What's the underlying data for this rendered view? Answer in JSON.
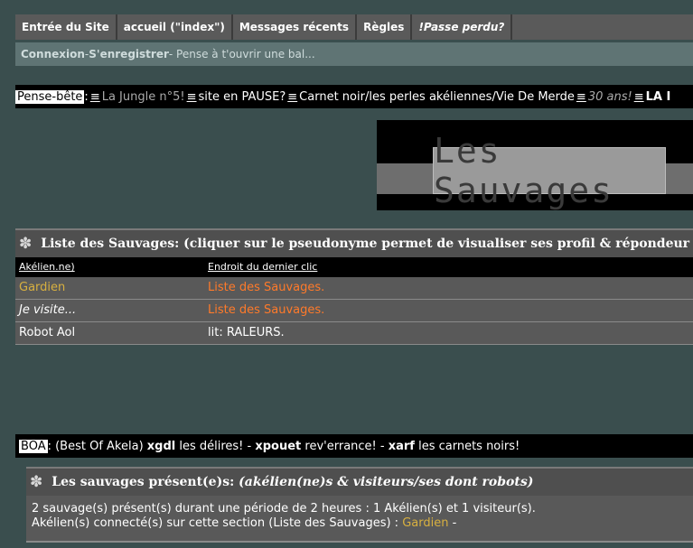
{
  "nav": {
    "items": [
      "Entrée du Site",
      "accueil (\"index\")",
      "Messages récents",
      "Règles",
      "!Passe perdu?"
    ]
  },
  "subnav": {
    "login": "Connexion",
    "sep": " - ",
    "register": "S'enregistrer",
    "note": " - Pense à t'ouvrir une bal..."
  },
  "pense": {
    "label": "Pense-bête",
    "colon": ":",
    "eq": "≡",
    "items": [
      "La Jungle n°5!",
      "site en PAUSE?",
      "Carnet noir/les perles akéliennes/Vie De Merde",
      "30 ans!",
      "LA I"
    ]
  },
  "banner": {
    "text": "Les Sauvages"
  },
  "list": {
    "title": "Liste des Sauvages: (cliquer sur le pseudonyme permet de visualiser ses profil & répondeur dom",
    "columns": [
      "Akélien.ne)",
      "Endroit du dernier clic"
    ],
    "rows": [
      {
        "name": "Gardien",
        "place": "Liste des Sauvages."
      },
      {
        "name": "Je visite...",
        "place": "Liste des Sauvages."
      },
      {
        "name": "Robot Aol",
        "place": "lit: RALEURS."
      }
    ]
  },
  "boa": {
    "label": "BOA",
    "intro": ": (Best Of Akela) ",
    "k1": "xgdl",
    "t1": " les délires! - ",
    "k2": "xpouet",
    "t2": " rev'errance! - ",
    "k3": "xarf",
    "t3": " les carnets noirs!"
  },
  "presents": {
    "title_main": "Les sauvages présent(e)s: ",
    "title_ital": "(akélien(ne)s & visiteurs/ses dont robots)",
    "line1": "2 sauvage(s) présent(s) durant une période de 2 heures : 1 Akélien(s) et 1 visiteur(s).",
    "line2_pre": "Akélien(s) connecté(s) sur cette section (Liste des Sauvages) : ",
    "line2_user": "Gardien",
    "line2_post": " -"
  },
  "colors": {
    "background": "#3a4e4e",
    "gold": "#d8b040",
    "orange": "#ff7a2a"
  }
}
